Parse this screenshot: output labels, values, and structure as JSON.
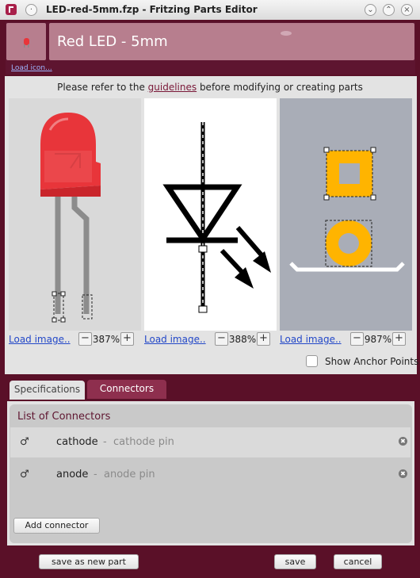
{
  "window": {
    "title": "LED-red-5mm.fzp - Fritzing Parts Editor",
    "menu_button": "·",
    "minimize": "⌄",
    "maximize": "⌃",
    "close": "×"
  },
  "header": {
    "part_title": "Red LED - 5mm",
    "load_icon": "Load icon..."
  },
  "guidelines": {
    "prefix": "Please refer to the ",
    "link": "guidelines",
    "suffix": " before modifying or creating parts"
  },
  "views": {
    "breadboard": {
      "load_label": "Load image..",
      "zoom": "387%",
      "zoom_minus": "−",
      "zoom_plus": "+"
    },
    "schematic": {
      "load_label": "Load image..",
      "zoom": "388%",
      "zoom_minus": "−",
      "zoom_plus": "+"
    },
    "pcb": {
      "load_label": "Load image..",
      "zoom": "987%",
      "zoom_minus": "−",
      "zoom_plus": "+"
    }
  },
  "anchor_points": {
    "label": "Show Anchor Points",
    "checked": false
  },
  "tabs": [
    {
      "label": "Specifications",
      "active": false
    },
    {
      "label": "Connectors",
      "active": true
    }
  ],
  "connectors": {
    "title": "List of Connectors",
    "separator": "-",
    "items": [
      {
        "name": "cathode",
        "description": "cathode pin",
        "icon": "male-symbol-icon"
      },
      {
        "name": "anode",
        "description": "anode pin",
        "icon": "male-symbol-icon"
      }
    ],
    "remove_glyph": "✖",
    "add_button": "Add connector"
  },
  "footer": {
    "save_as_new": "save as new part",
    "save": "save",
    "cancel": "cancel"
  },
  "colors": {
    "frame": "#5a1028",
    "title_box": "#b77e8e",
    "led_red": "#e8353a",
    "pcb_copper": "#ffb400",
    "pcb_background": "#a9adb7"
  }
}
